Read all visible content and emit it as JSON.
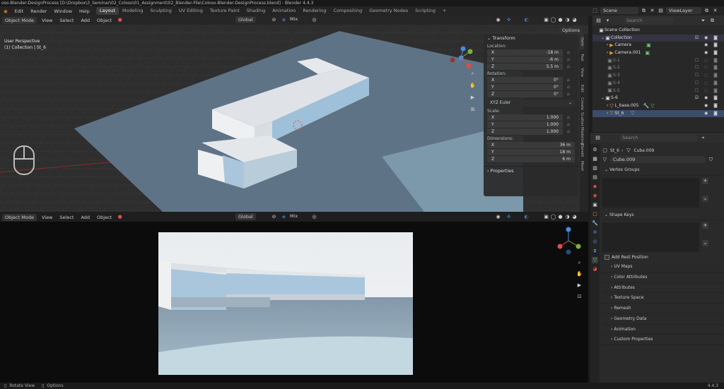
{
  "title_bar": "oso-Blender-DesignProcess [D:\\Dropbox\\3_Seminar\\02_Coloso\\01_Assignment\\02_Blender-File\\Coloso-Blender-DesignProcess.blend] - Blender 4.4.3",
  "menus": [
    "Edit",
    "Render",
    "Window",
    "Help"
  ],
  "workspaces": [
    "Layout",
    "Modeling",
    "Sculpting",
    "UV Editing",
    "Texture Paint",
    "Shading",
    "Animation",
    "Rendering",
    "Compositing",
    "Geometry Nodes",
    "Scripting"
  ],
  "add_workspace": "+",
  "scene_label": "Scene",
  "view_layer_label": "ViewLayer",
  "viewport_top": {
    "mode": "Object Mode",
    "menus": [
      "View",
      "Select",
      "Add",
      "Object"
    ],
    "orientation": "Global",
    "shading_mix": "Mix",
    "options": "Options",
    "overlay_line1": "User Perspective",
    "overlay_line2": "(1) Collection | St_6",
    "side_tabs": [
      "Item",
      "Tool",
      "View",
      "Edit",
      "Create",
      "Scatter",
      "Modeling",
      "Blendit",
      "Mesh"
    ]
  },
  "npanel": {
    "header": "Transform",
    "location_label": "Location:",
    "location": [
      {
        "axis": "X",
        "value": "-18 m"
      },
      {
        "axis": "Y",
        "value": "-6 m"
      },
      {
        "axis": "Z",
        "value": "5.5 m"
      }
    ],
    "rotation_label": "Rotation:",
    "rotation": [
      {
        "axis": "X",
        "value": "0°"
      },
      {
        "axis": "Y",
        "value": "0°"
      },
      {
        "axis": "Z",
        "value": "0°"
      }
    ],
    "euler": "XYZ Euler",
    "scale_label": "Scale:",
    "scale": [
      {
        "axis": "X",
        "value": "1.000"
      },
      {
        "axis": "Y",
        "value": "1.000"
      },
      {
        "axis": "Z",
        "value": "1.000"
      }
    ],
    "dimensions_label": "Dimensions:",
    "dimensions": [
      {
        "axis": "X",
        "value": "36 m"
      },
      {
        "axis": "Y",
        "value": "18 m"
      },
      {
        "axis": "Z",
        "value": "6 m"
      }
    ],
    "properties": "Properties"
  },
  "viewport_bottom": {
    "mode": "Object Mode",
    "menus": [
      "View",
      "Select",
      "Add",
      "Object"
    ],
    "orientation": "Global",
    "shading_mix": "Mix"
  },
  "outliner": {
    "search_placeholder": "Search",
    "scene_collection": "Scene Collection",
    "items": [
      {
        "label": "Collection",
        "depth": 1,
        "icon": "collection"
      },
      {
        "label": "Camera",
        "depth": 2,
        "icon": "camera"
      },
      {
        "label": "Camera.001",
        "depth": 2,
        "icon": "camera"
      },
      {
        "label": "S-1",
        "depth": 1,
        "icon": "collection"
      },
      {
        "label": "S-2",
        "depth": 1,
        "icon": "collection"
      },
      {
        "label": "S-3",
        "depth": 1,
        "icon": "collection"
      },
      {
        "label": "S-4",
        "depth": 1,
        "icon": "collection"
      },
      {
        "label": "S-5",
        "depth": 1,
        "icon": "collection"
      },
      {
        "label": "S-6",
        "depth": 1,
        "icon": "collection"
      },
      {
        "label": "L_base.005",
        "depth": 2,
        "icon": "mesh"
      },
      {
        "label": "St_6",
        "depth": 2,
        "icon": "mesh"
      }
    ]
  },
  "properties": {
    "search_placeholder": "Search",
    "object_name": "St_6",
    "mesh_name": "Cube.009",
    "mesh_data_name": "Cube.009",
    "vertex_groups": "Vertex Groups",
    "shape_keys": "Shape Keys",
    "add_rest_position": "Add Rest Position",
    "sections": [
      "UV Maps",
      "Color Attributes",
      "Attributes",
      "Texture Space",
      "Remesh",
      "Geometry Data",
      "Animation",
      "Custom Properties"
    ]
  },
  "status_bar": {
    "rotate_view": "Rotate View",
    "options": "Options",
    "version": "4.4.3"
  },
  "colors": {
    "accent_blue": "#4a78b5",
    "axis_x": "#e04d4d",
    "axis_y": "#7ab33a",
    "axis_z": "#4a8ae0",
    "mesh_icon": "#e09a3a",
    "data_icon": "#6fcf6f"
  }
}
